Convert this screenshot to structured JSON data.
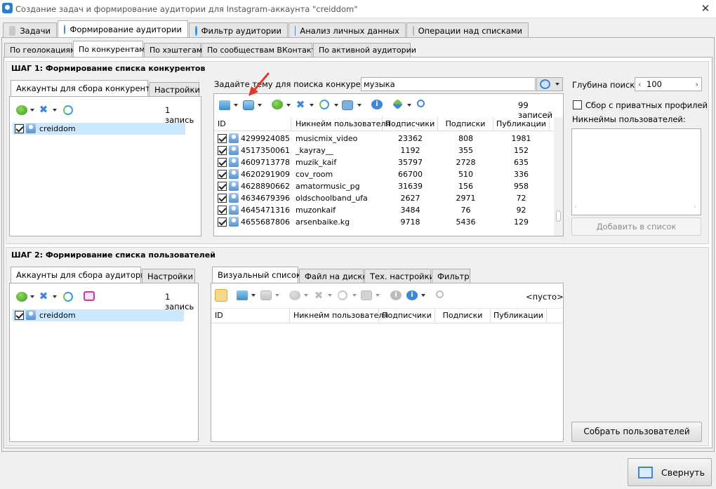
{
  "window": {
    "title": "Создание задач и формирование аудитории для Instagram-аккаунта \"creiddom\"",
    "close": "✕"
  },
  "main_tabs": [
    {
      "label": "Задачи",
      "icon": "tasks-icon"
    },
    {
      "label": "Формирование аудитории",
      "icon": "audience-icon"
    },
    {
      "label": "Фильтр аудитории",
      "icon": "filter-icon"
    },
    {
      "label": "Анализ личных данных",
      "icon": "analysis-icon"
    },
    {
      "label": "Операции над списками",
      "icon": "list-ops-icon"
    }
  ],
  "sub_tabs": [
    "По геолокациям",
    "По конкурентам",
    "По хэштегам",
    "По сообществам ВКонтакте",
    "По активной аудитории"
  ],
  "step1": {
    "title": "ШАГ 1: Формирование списка конкурентов",
    "left_tabs": [
      "Аккаунты для сбора конкурентов",
      "Настройки"
    ],
    "left_count": "1 запись",
    "accounts": [
      "creiddom"
    ],
    "topic_label": "Задайте тему для поиска конкурентов:",
    "topic_value": "музыка",
    "depth_label": "Глубина поиска:",
    "depth_value": "100",
    "private_label": "Сбор с приватных профилей",
    "nicknames_label": "Никнеймы пользователей:",
    "add_button": "Добавить в список",
    "records": "99 записей",
    "columns": [
      "ID",
      "Никнейм пользователя",
      "Подписчики",
      "Подписки",
      "Публикации"
    ],
    "rows": [
      [
        "4299924085",
        "musicmix_video",
        "23362",
        "808",
        "1981"
      ],
      [
        "4517350061",
        "_kayray__",
        "1192",
        "355",
        "152"
      ],
      [
        "4609713778",
        "muzik_kaif",
        "35797",
        "2728",
        "635"
      ],
      [
        "4620291909",
        "cov_room",
        "66700",
        "510",
        "336"
      ],
      [
        "4628890662",
        "amatormusic_pg",
        "31639",
        "156",
        "958"
      ],
      [
        "4634679396",
        "oldschoolband_ufa",
        "2627",
        "2971",
        "72"
      ],
      [
        "4645471316",
        "muzonkaif",
        "3484",
        "76",
        "92"
      ],
      [
        "4655687806",
        "arsenbaike.kg",
        "9718",
        "5436",
        "129"
      ]
    ]
  },
  "step2": {
    "title": "ШАГ 2: Формирование списка пользователей",
    "left_tabs": [
      "Аккаунты для сбора аудитории",
      "Настройки"
    ],
    "left_count": "1 запись",
    "accounts": [
      "creiddom"
    ],
    "right_tabs": [
      "Визуальный список",
      "Файл на диске",
      "Тех. настройки",
      "Фильтр"
    ],
    "empty": "<пусто>",
    "columns": [
      "ID",
      "Никнейм пользователя",
      "Подписчики",
      "Подписки",
      "Публикации"
    ],
    "collect_button": "Собрать пользователей"
  },
  "footer": {
    "collapse_button": "Свернуть"
  },
  "colors": {
    "accent": "#3d86d8",
    "selected_row": "#cce8ff",
    "arrow": "#e03a2a"
  }
}
